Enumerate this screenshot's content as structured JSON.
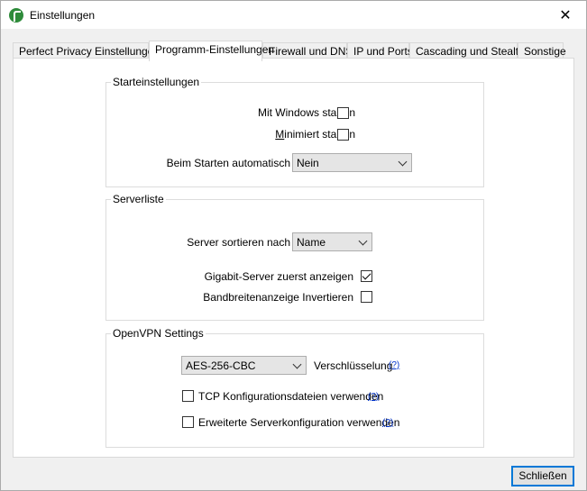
{
  "window": {
    "title": "Einstellungen",
    "close_glyph": "✕"
  },
  "tabs": [
    {
      "label": "Perfect Privacy Einstellungen",
      "active": false
    },
    {
      "label": "Programm-Einstellungen",
      "active": true
    },
    {
      "label": "Firewall und DNS",
      "active": false
    },
    {
      "label": "IP und Ports",
      "active": false
    },
    {
      "label": "Cascading und Stealth",
      "active": false
    },
    {
      "label": "Sonstige",
      "active": false
    }
  ],
  "start_group": {
    "legend": "Starteinstellungen",
    "with_windows": {
      "label": "Mit Windows starten",
      "checked": false
    },
    "minimized": {
      "label": "Minimiert starten",
      "checked": false
    },
    "auto_start": {
      "label": "Beim Starten automatisch",
      "value": "Nein"
    }
  },
  "server_group": {
    "legend": "Serverliste",
    "sort": {
      "label": "Server sortieren nach",
      "value": "Name"
    },
    "gigabit_first": {
      "label": "Gigabit-Server zuerst anzeigen",
      "checked": true
    },
    "invert_bandwidth": {
      "label": "Bandbreitenanzeige Invertieren",
      "checked": false
    }
  },
  "openvpn_group": {
    "legend": "OpenVPN Settings",
    "cipher": {
      "value": "AES-256-CBC",
      "label": "Verschlüsselung",
      "help": "(?)"
    },
    "tcp_config": {
      "label": "TCP Konfigurationsdateien verwenden",
      "help": "(?)",
      "checked": false
    },
    "extended_config": {
      "label": "Erweiterte Serverkonfiguration verwenden",
      "help": "(?)",
      "checked": false
    }
  },
  "footer": {
    "close_label": "Schließen"
  },
  "icons": {
    "app": "leaf-app-icon",
    "close": "close-icon",
    "dropdown": "chevron-down-icon"
  }
}
